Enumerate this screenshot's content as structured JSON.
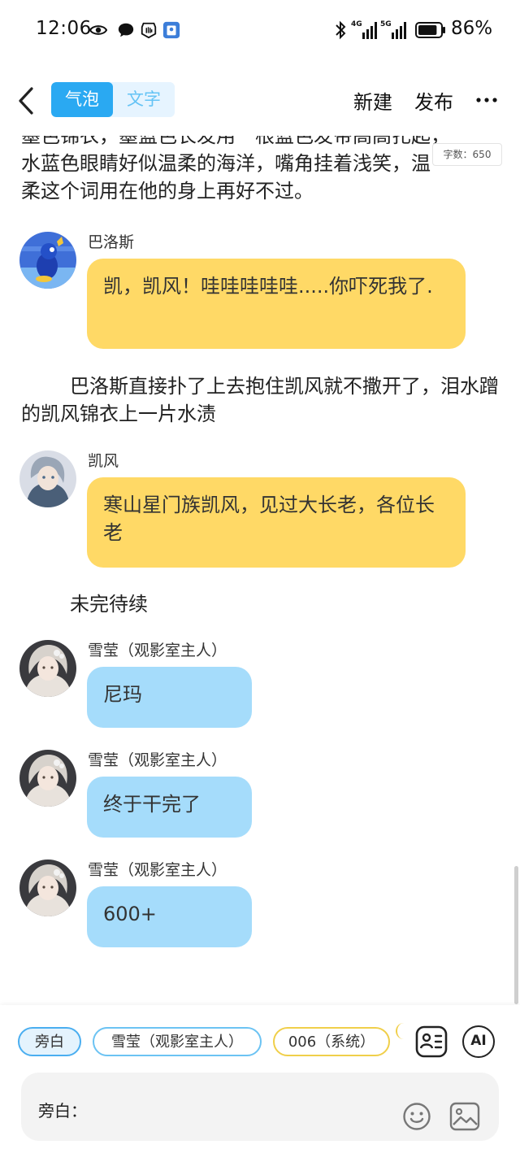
{
  "status_bar": {
    "time": "12:06",
    "network_left": "4G",
    "network_right": "5G",
    "battery_percent": "86%",
    "battery_level": 0.86,
    "icons": [
      "eye-icon",
      "chat-bubble-icon",
      "hand-icon",
      "app-icon",
      "bluetooth-icon",
      "signal-icon",
      "battery-icon"
    ]
  },
  "nav": {
    "back_icon": "chevron-left-icon",
    "mode_bubble": "气泡",
    "mode_text": "文字",
    "new_label": "新建",
    "publish_label": "发布",
    "more_icon": "more-dots-icon"
  },
  "content": {
    "top_paragraph_line1": "墨色锦衣，墨蓝色长发用一根蓝色发带高高扎起，",
    "top_paragraph_line2": "水蓝色眼睛好似温柔的海洋，嘴角挂着浅笑，温",
    "top_paragraph_line3": "柔这个词用在他的身上再好不过。",
    "word_count": "字数：650",
    "msg1": {
      "name": "巴洛斯",
      "text": "凯，凯风！哇哇哇哇哇.....你吓死我了."
    },
    "narration1": "巴洛斯直接扑了上去抱住凯风就不撒开了，泪水蹭的凯风锦衣上一片水渍",
    "msg2": {
      "name": "凯风",
      "text": "寒山星门族凯风，见过大长老，各位长老"
    },
    "narration2": "未完待续",
    "msg3": {
      "name": "雪莹（观影室主人）",
      "text": "尼玛"
    },
    "msg4": {
      "name": "雪莹（观影室主人）",
      "text": "终于干完了"
    },
    "msg5": {
      "name": "雪莹（观影室主人）",
      "text": "600+"
    }
  },
  "bottom": {
    "chip_narrator": "旁白",
    "chip_xueying": "雪莹（观影室主人）",
    "chip_system": "006（系统）",
    "ai_label": "AI",
    "input_label": "旁白：",
    "icons": [
      "role-card-icon",
      "emoji-icon",
      "image-icon"
    ]
  },
  "colors": {
    "accent_blue": "#2aa9f2",
    "bubble_yellow": "#ffd966",
    "bubble_blue": "#a5dcfb"
  }
}
